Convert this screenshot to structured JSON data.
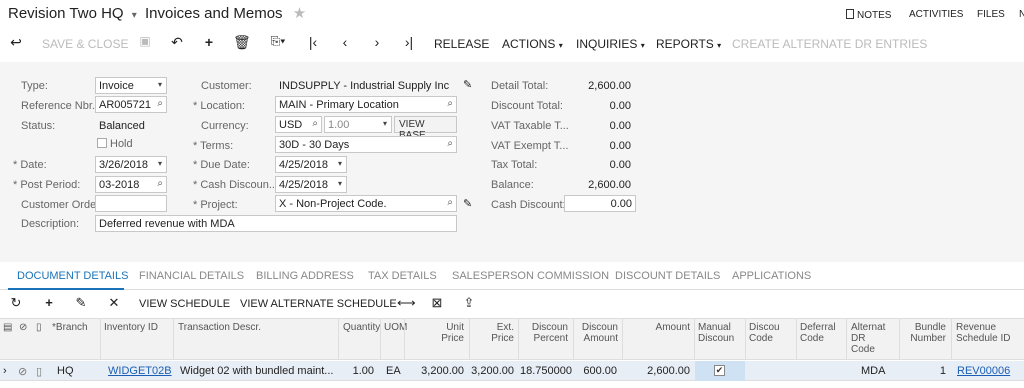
{
  "header": {
    "company": "Revision Two HQ",
    "screen_title": "Invoices and Memos",
    "links": [
      "NOTES",
      "ACTIVITIES",
      "FILES",
      "N"
    ]
  },
  "toolbar": {
    "save_close": "SAVE & CLOSE",
    "release": "RELEASE",
    "actions": "ACTIONS",
    "inquiries": "INQUIRIES",
    "reports": "REPORTS",
    "create_alt_dr": "CREATE ALTERNATE DR ENTRIES"
  },
  "form": {
    "type_label": "Type:",
    "type_value": "Invoice",
    "ref_label": "Reference Nbr.:",
    "ref_value": "AR005721",
    "status_label": "Status:",
    "status_value": "Balanced",
    "hold_label": "Hold",
    "date_label": "Date:",
    "date_value": "3/26/2018",
    "period_label": "Post Period:",
    "period_value": "03-2018",
    "customer_order_label": "Customer Order:",
    "customer_order_value": "",
    "description_label": "Description:",
    "description_value": "Deferred revenue with MDA",
    "customer_label": "Customer:",
    "customer_value": "INDSUPPLY - Industrial Supply Inc",
    "location_label": "Location:",
    "location_value": "MAIN - Primary Location",
    "currency_label": "Currency:",
    "currency_value": "USD",
    "currency_rate": "1.00",
    "view_base": "VIEW BASE",
    "terms_label": "Terms:",
    "terms_value": "30D - 30 Days",
    "due_label": "Due Date:",
    "due_value": "4/25/2018",
    "cashdisc_label": "Cash Discoun...",
    "cashdisc_value": "4/25/2018",
    "project_label": "Project:",
    "project_value": "X - Non-Project Code.",
    "detail_total_label": "Detail Total:",
    "detail_total_value": "2,600.00",
    "discount_total_label": "Discount Total:",
    "discount_total_value": "0.00",
    "vat_taxable_label": "VAT Taxable T...",
    "vat_taxable_value": "0.00",
    "vat_exempt_label": "VAT Exempt T...",
    "vat_exempt_value": "0.00",
    "tax_total_label": "Tax Total:",
    "tax_total_value": "0.00",
    "balance_label": "Balance:",
    "balance_value": "2,600.00",
    "cash_discount_label": "Cash Discount:",
    "cash_discount_value": "0.00"
  },
  "tabs": [
    "DOCUMENT DETAILS",
    "FINANCIAL DETAILS",
    "BILLING ADDRESS",
    "TAX DETAILS",
    "SALESPERSON COMMISSION",
    "DISCOUNT DETAILS",
    "APPLICATIONS"
  ],
  "grid_toolbar": {
    "view_schedule": "VIEW SCHEDULE",
    "view_alt_schedule": "VIEW ALTERNATE SCHEDULE"
  },
  "grid": {
    "headers": {
      "branch": "Branch",
      "inventory": "Inventory ID",
      "descr": "Transaction Descr.",
      "qty": "Quantity",
      "uom": "UOM",
      "unit_price_1": "Unit",
      "unit_price_2": "Price",
      "ext_price_1": "Ext.",
      "ext_price_2": "Price",
      "disc_pct_1": "Discoun",
      "disc_pct_2": "Percent",
      "disc_amt_1": "Discoun",
      "disc_amt_2": "Amount",
      "amount": "Amount",
      "manual_1": "Manual",
      "manual_2": "Discoun",
      "disc_code_1": "Discou",
      "disc_code_2": "Code",
      "deferral_1": "Deferral",
      "deferral_2": "Code",
      "alt_dr_1": "Alternat",
      "alt_dr_2": "DR",
      "alt_dr_3": "Code",
      "bundle_1": "Bundle",
      "bundle_2": "Number",
      "rev_sched_1": "Revenue",
      "rev_sched_2": "Schedule ID"
    },
    "row": {
      "branch": "HQ",
      "inventory": "WIDGET02B",
      "descr": "Widget 02 with bundled maint...",
      "qty": "1.00",
      "uom": "EA",
      "unit_price": "3,200.00",
      "ext_price": "3,200.00",
      "disc_pct": "18.750000",
      "disc_amt": "600.00",
      "amount": "2,600.00",
      "alt_dr": "MDA",
      "bundle": "1",
      "rev_sched": "REV00006"
    }
  }
}
